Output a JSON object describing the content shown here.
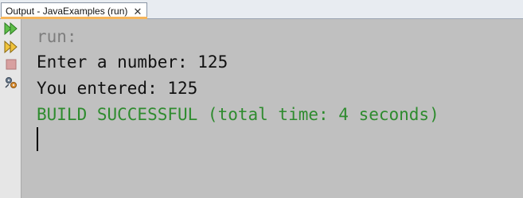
{
  "tab": {
    "title": "Output - JavaExamples (run)",
    "close_glyph": "✕"
  },
  "gutter": {
    "buttons": [
      "rerun-icon",
      "rerun-with-args-icon",
      "stop-icon",
      "settings-icon"
    ]
  },
  "console": {
    "run_line": "run:",
    "prompt_line": "Enter a number: 125",
    "echo_line": "You entered: 125",
    "build_line": "BUILD SUCCESSFUL (total time: 4 seconds)"
  },
  "colors": {
    "background": "#c0c0c0",
    "run_text": "#7d7d7d",
    "output_text": "#111111",
    "success_text": "#2e8b2e",
    "tab_accent": "#f6b55a"
  }
}
